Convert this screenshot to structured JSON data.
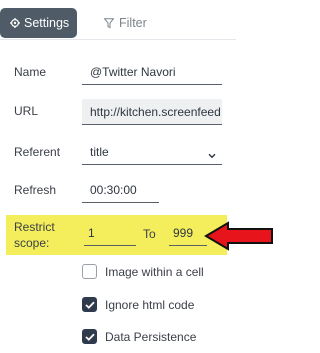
{
  "tabs": {
    "settings_label": "Settings",
    "filter_label": "Filter"
  },
  "form": {
    "name": {
      "label": "Name",
      "value": "@Twitter Navori"
    },
    "url": {
      "label": "URL",
      "value": "http://kitchen.screenfeed"
    },
    "referent": {
      "label": "Referent",
      "value": "title"
    },
    "refresh": {
      "label": "Refresh",
      "value": "00:30:00"
    },
    "restrict_scope": {
      "label_line1": "Restrict",
      "label_line2": "scope:",
      "from": "1",
      "to_label": "To",
      "to": "999"
    }
  },
  "options": [
    {
      "label": "Image within a cell",
      "checked": false
    },
    {
      "label": "Ignore html code",
      "checked": true
    },
    {
      "label": "Data Persistence",
      "checked": true
    }
  ],
  "colors": {
    "highlight": "#f4ee5c",
    "arrow": "#e8141c",
    "tab_active": "#4f5b66"
  }
}
